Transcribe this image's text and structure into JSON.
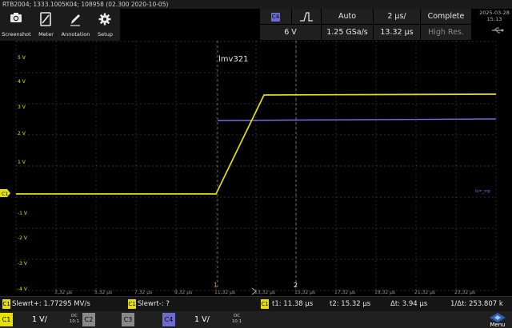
{
  "title": "RTB2004; 1333.1005K04; 108958 (02.300 2020-10-05)",
  "toolbar": {
    "screenshot": "Screenshot",
    "meter": "Meter",
    "annotation": "Annotation",
    "setup": "Setup"
  },
  "acquisition": {
    "channel": "C4",
    "level": "6 V",
    "mode": "Auto",
    "sample_rate": "1.25 GSa/s",
    "timebase": "2 µs/",
    "position": "13.32 µs",
    "state": "Complete",
    "resolution": "High Res."
  },
  "clock": {
    "date": "2025-03-28",
    "time": "15:13"
  },
  "plot": {
    "label": "lmv321",
    "channel_marker": "C1",
    "bus_label": "lo=_mp",
    "cursor1": "1",
    "cursor2": "2",
    "y_labels": [
      "5 V",
      "4 V",
      "3 V",
      "2 V",
      "1 V",
      "-1 V",
      "-2 V",
      "-3 V",
      "-4 V"
    ],
    "x_labels": [
      "3,32 µs",
      "5,32 µs",
      "7,32 µs",
      "9,32 µs",
      "11,32 µs",
      "13,32 µs",
      "15,32 µs",
      "17,32 µs",
      "19,32 µs",
      "21,32 µs",
      "23,32 µs"
    ]
  },
  "status": {
    "c1": "C1",
    "slew_pos": "Slewrt+: 1.77295 MV/s",
    "slew_neg": "Slewrt-: ?",
    "t1": "t1: 11.38 µs",
    "t2": "t2: 15.32 µs",
    "dt": "Δt: 3.94 µs",
    "inv_dt": "1/Δt: 253.807 k"
  },
  "channels": [
    {
      "id": "C1",
      "scale": "1 V/",
      "coupling": "DC",
      "probe": "10:1",
      "color": "#e6e000"
    },
    {
      "id": "C2",
      "scale": "",
      "coupling": "",
      "probe": "",
      "color": "#8a8a8a"
    },
    {
      "id": "C3",
      "scale": "",
      "coupling": "",
      "probe": "",
      "color": "#8a8a8a"
    },
    {
      "id": "C4",
      "scale": "1 V/",
      "coupling": "DC",
      "probe": "10:1",
      "color": "#6b6bd6"
    }
  ],
  "menu_label": "Menu",
  "colors": {
    "ch1": "#e6e000",
    "ch4": "#7070e0",
    "grid": "#3a3a3a",
    "cursor": "#8a8a8a"
  }
}
